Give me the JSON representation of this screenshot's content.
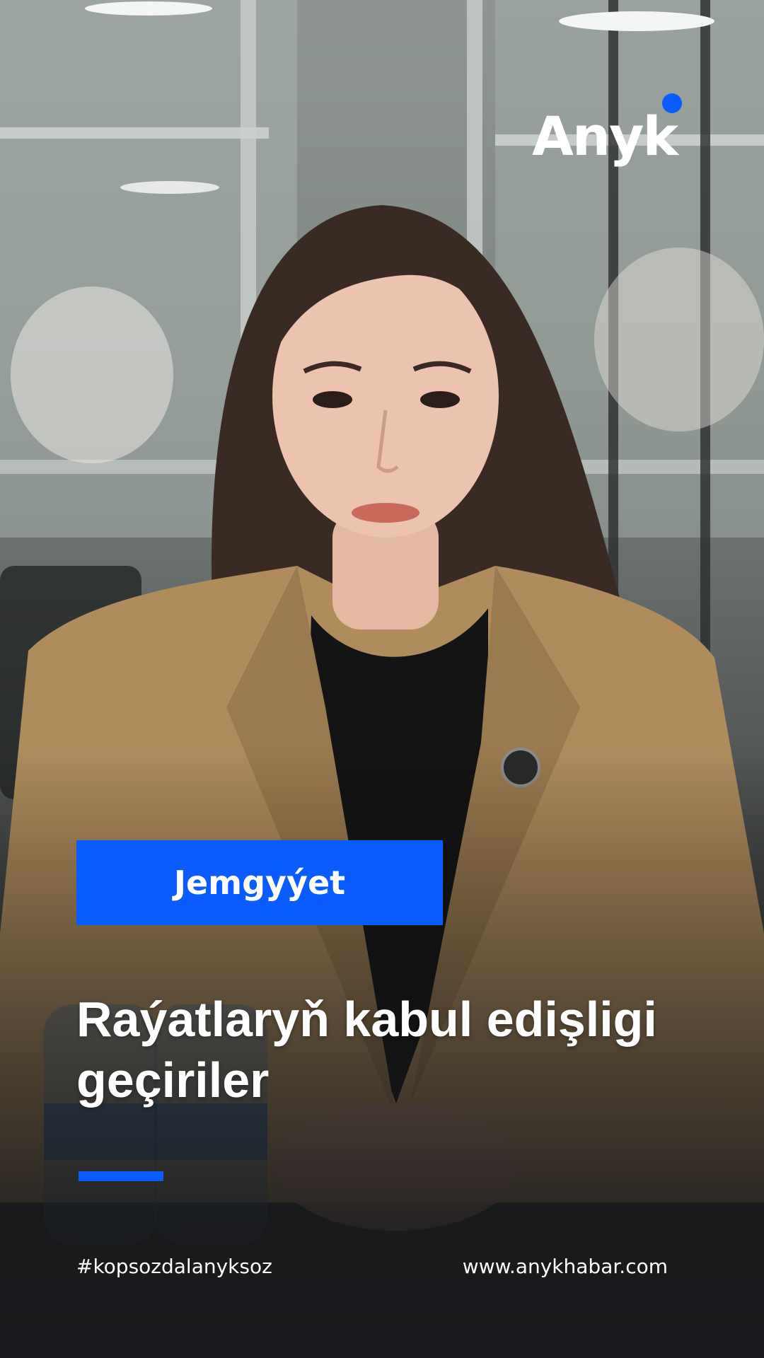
{
  "brand": {
    "logo_text": "Anyk",
    "accent_color": "#0a5cff"
  },
  "category": {
    "label": "Jemgyýet"
  },
  "headline": {
    "text": "Raýatlaryň kabul edişligi geçiriler"
  },
  "footer": {
    "hashtag": "#kopsozdalanyksoz",
    "website": "www.anykhabar.com"
  },
  "colors": {
    "accent": "#0a5cff",
    "text": "#ffffff",
    "blazer": "#b08c5d",
    "background_dark": "#1a1b1e"
  }
}
